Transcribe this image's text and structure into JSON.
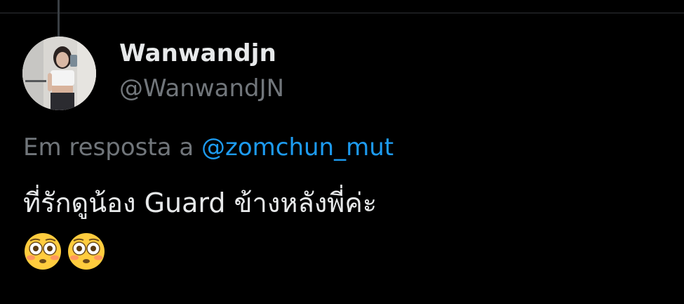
{
  "tweet": {
    "author": {
      "display_name": "Wanwandjn",
      "handle": "@WanwandJN",
      "avatar": "profile-photo"
    },
    "reply_prefix": "Em resposta a",
    "reply_to": "@zomchun_mut",
    "text": "ที่รักดูน้อง Guard ข้างหลังพี่ค่ะ",
    "emojis": [
      "flushed-face-icon",
      "flushed-face-icon"
    ]
  },
  "colors": {
    "background": "#000000",
    "text_primary": "#e7e9ea",
    "text_secondary": "#71767b",
    "link": "#1d9bf0",
    "divider": "#2f3336"
  }
}
